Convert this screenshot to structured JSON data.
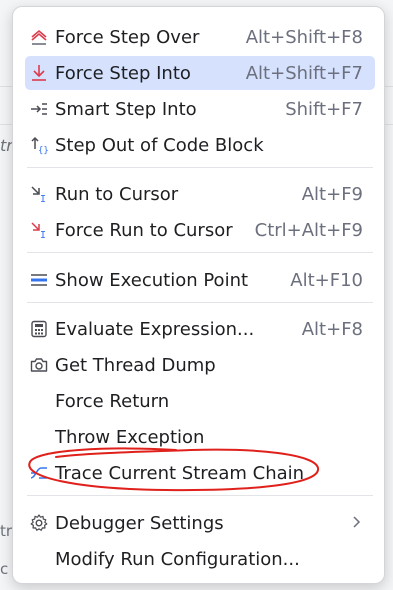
{
  "background": {
    "left_fragment_1": "tr",
    "left_fragment_2": "tr",
    "left_fragment_3": "c"
  },
  "menu": {
    "items": [
      {
        "label": "Force Step Over",
        "shortcut": "Alt+Shift+F8",
        "icon": "force-step-over-icon"
      },
      {
        "label": "Force Step Into",
        "shortcut": "Alt+Shift+F7",
        "icon": "force-step-into-icon"
      },
      {
        "label": "Smart Step Into",
        "shortcut": "Shift+F7",
        "icon": "smart-step-into-icon"
      },
      {
        "label": "Step Out of Code Block",
        "shortcut": "",
        "icon": "step-out-code-block-icon"
      },
      {
        "label": "Run to Cursor",
        "shortcut": "Alt+F9",
        "icon": "run-to-cursor-icon"
      },
      {
        "label": "Force Run to Cursor",
        "shortcut": "Ctrl+Alt+F9",
        "icon": "force-run-to-cursor-icon"
      },
      {
        "label": "Show Execution Point",
        "shortcut": "Alt+F10",
        "icon": "show-execution-point-icon"
      },
      {
        "label": "Evaluate Expression...",
        "shortcut": "Alt+F8",
        "icon": "calculator-icon"
      },
      {
        "label": "Get Thread Dump",
        "shortcut": "",
        "icon": "camera-icon"
      },
      {
        "label": "Force Return",
        "shortcut": ""
      },
      {
        "label": "Throw Exception",
        "shortcut": ""
      },
      {
        "label": "Trace Current Stream Chain",
        "shortcut": "",
        "icon": "stream-trace-icon"
      },
      {
        "label": "Debugger Settings",
        "shortcut": "",
        "icon": "gear-icon",
        "submenu_icon": "chevron-right-icon"
      },
      {
        "label": "Modify Run Configuration...",
        "shortcut": ""
      }
    ],
    "selected_index": 1,
    "colors": {
      "selected_bg": "#d5e1fd",
      "annotation_red": "#e0201b",
      "icon_red": "#db3b4b",
      "icon_blue": "#3574f0"
    }
  }
}
